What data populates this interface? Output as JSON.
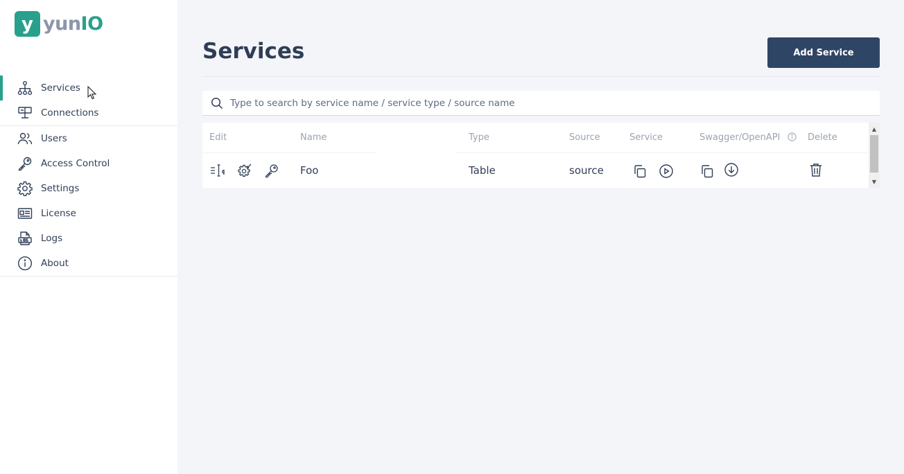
{
  "brand": {
    "mark": "y",
    "name_part1": "yun",
    "name_part2": "IO"
  },
  "sidebar": {
    "groups": [
      {
        "items": [
          {
            "label": "Services",
            "icon": "sitemap-icon",
            "active": true
          },
          {
            "label": "Connections",
            "icon": "connections-icon",
            "active": false
          }
        ]
      },
      {
        "items": [
          {
            "label": "Users",
            "icon": "users-icon",
            "active": false
          },
          {
            "label": "Access Control",
            "icon": "key-icon",
            "active": false
          },
          {
            "label": "Settings",
            "icon": "gear-icon",
            "active": false
          },
          {
            "label": "License",
            "icon": "id-card-icon",
            "active": false
          },
          {
            "label": "Logs",
            "icon": "logs-icon",
            "active": false
          },
          {
            "label": "About",
            "icon": "info-icon",
            "active": false
          }
        ]
      }
    ]
  },
  "main": {
    "title": "Services",
    "add_button": "Add Service",
    "search": {
      "placeholder": "Type to search by service name / service type / source name",
      "value": ""
    }
  },
  "table": {
    "headers": {
      "edit": "Edit",
      "name": "Name",
      "type": "Type",
      "source": "Source",
      "service": "Service",
      "swagger": "Swagger/OpenAPI",
      "delete": "Delete"
    },
    "rows": [
      {
        "name": "Foo",
        "type": "Table",
        "source": "source"
      }
    ]
  },
  "colors": {
    "accent": "#28a08c",
    "primary": "#2f4565",
    "text": "#2f3e56",
    "muted": "#9aa3b2"
  }
}
